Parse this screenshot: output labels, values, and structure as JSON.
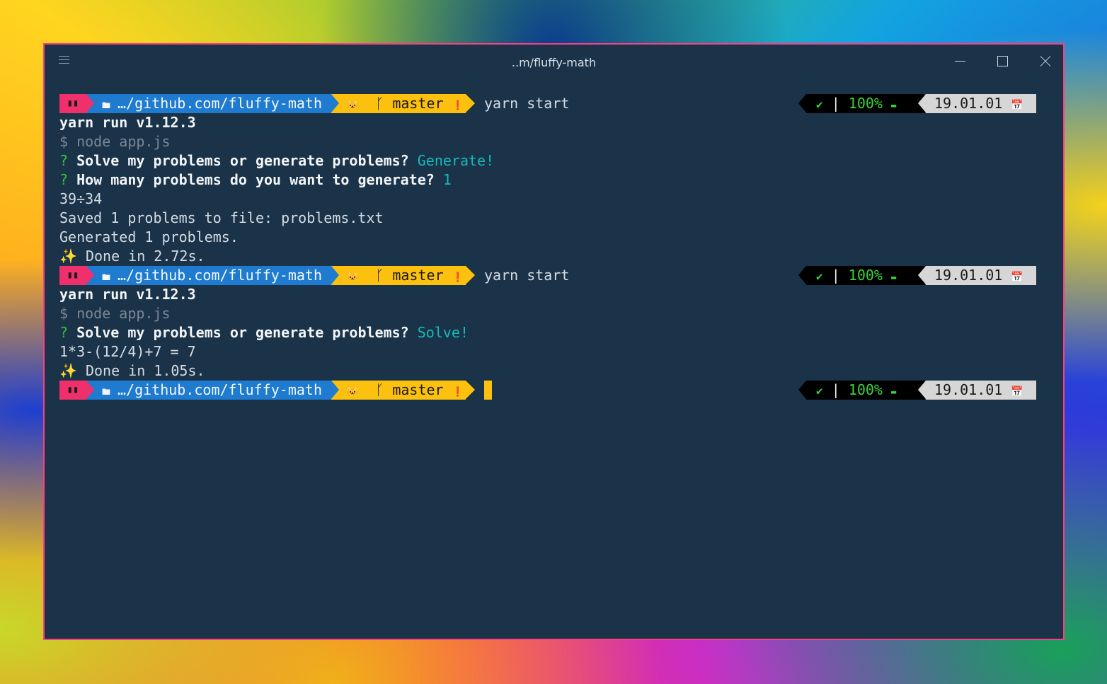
{
  "window": {
    "title": "..m/fluffy-math",
    "border_color": "#ff3e82",
    "background": "#1a3349"
  },
  "icons": {
    "menu": "hamburger-icon",
    "minimize": "minimize-icon",
    "maximize": "maximize-icon",
    "close": "close-icon",
    "folder": "folder-icon",
    "git_host": "github-cat-icon",
    "branch": "git-branch-icon",
    "status": "exclamation-circle-icon",
    "success": "check-icon",
    "battery": "battery-icon",
    "calendar": "calendar-icon"
  },
  "prompt": {
    "terminal_icon": "▮▮",
    "folder_glyph": "🖿",
    "path": "…/github.com/fluffy-math",
    "git_glyph": "🐱",
    "branch_glyph": "ᚴ",
    "branch": "master",
    "status_glyph": "❗",
    "check_glyph": "✔",
    "separator": "|",
    "battery": "100%",
    "battery_glyph": "▬",
    "date": "19.01.01",
    "calendar_glyph": "📅"
  },
  "session": {
    "run1": {
      "command": "yarn start",
      "yarn_version": "yarn run v1.12.3",
      "node_cmd": "$ node app.js",
      "q_mark": "?",
      "q1": "Solve my problems or generate problems?",
      "a1": "Generate!",
      "q2": "How many problems do you want to generate?",
      "a2": "1",
      "out1": "39÷34",
      "out2": "Saved 1 problems to file: problems.txt",
      "out3": "Generated 1 problems.",
      "done_icon": "✨",
      "done": "Done in 2.72s."
    },
    "run2": {
      "command": "yarn start",
      "yarn_version": "yarn run v1.12.3",
      "node_cmd": "$ node app.js",
      "q_mark": "?",
      "q1": "Solve my problems or generate problems?",
      "a1": "Solve!",
      "out1": "1*3-(12/4)+7 = 7",
      "done_icon": "✨",
      "done": "Done in 1.05s."
    }
  }
}
